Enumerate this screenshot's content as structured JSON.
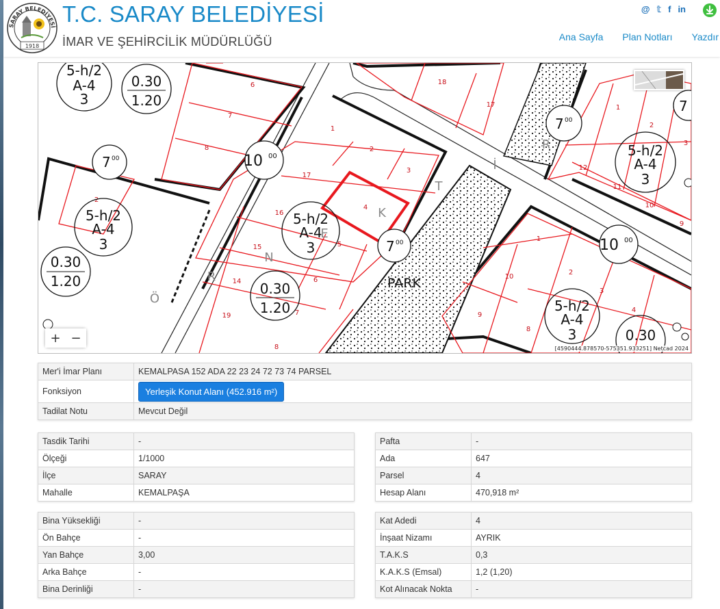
{
  "header": {
    "title": "T.C. SARAY BELEDİYESİ",
    "subtitle": "İMAR VE ŞEHİRCİLİK MÜDÜRLÜĞÜ",
    "logo": {
      "ring_text": "SARAY BELEDİYESİ",
      "year": "1918"
    },
    "socials": {
      "email": "@",
      "twitter": "𝕥",
      "facebook": "f",
      "linkedin": "in"
    },
    "nav": [
      "Ana Sayfa",
      "Plan Notları",
      "Yazdır"
    ]
  },
  "map": {
    "park_label": "PARK",
    "street_letters": [
      "Ö",
      "R",
      "N",
      "E",
      "K",
      "T",
      "İ",
      "R"
    ],
    "parcels_top_left": [
      "6",
      "7",
      "8",
      "2"
    ],
    "parcels_center": [
      "1",
      "2",
      "3",
      "17",
      "16",
      "15",
      "14",
      "19",
      "4",
      "5",
      "6",
      "7",
      "8"
    ],
    "parcels_right": [
      "18",
      "17",
      "1",
      "2",
      "3",
      "12",
      "11",
      "10",
      "9",
      "1",
      "2",
      "3",
      "4",
      "10",
      "9",
      "8"
    ],
    "zones": [
      {
        "top": "5-h/2",
        "mid": "A-4",
        "bot": "3"
      },
      {
        "top": "5-h/2",
        "mid": "A-4",
        "bot": "3"
      },
      {
        "top": "5-h/2",
        "mid": "A-4",
        "bot": "3"
      },
      {
        "top": "5-h/2",
        "mid": "A-4",
        "bot": "3"
      },
      {
        "top": "5-h/2",
        "mid": "A-4",
        "bot": "3"
      }
    ],
    "ratios": [
      {
        "top": "0.30",
        "bot": "1.20"
      },
      {
        "top": "0.30",
        "bot": "1.20"
      },
      {
        "top": "0.30",
        "bot": "1.20"
      },
      {
        "top": "0.30",
        "bot": ""
      }
    ],
    "road_widths": {
      "main": "10",
      "sub": "00",
      "small": "7",
      "small_sub": "00"
    },
    "zoom_in": "+",
    "zoom_out": "−",
    "coords": "[4590444.878570-575351.933251] Netcad 2024"
  },
  "plan_table": {
    "rows": [
      {
        "label": "Mer'i İmar Planı",
        "value": "KEMALPASA 152 ADA 22 23 24 72 73 74 PARSEL"
      },
      {
        "label": "Fonksiyon",
        "value": "Yerleşik Konut Alanı (452.916 m²)"
      },
      {
        "label": "Tadilat Notu",
        "value": "Mevcut Değil"
      }
    ]
  },
  "info_left": {
    "rows": [
      {
        "label": "Tasdik Tarihi",
        "value": "-"
      },
      {
        "label": "Ölçeği",
        "value": "1/1000"
      },
      {
        "label": "İlçe",
        "value": "SARAY"
      },
      {
        "label": "Mahalle",
        "value": "KEMALPAŞA"
      }
    ]
  },
  "info_right": {
    "rows": [
      {
        "label": "Pafta",
        "value": "-"
      },
      {
        "label": "Ada",
        "value": "647"
      },
      {
        "label": "Parsel",
        "value": "4"
      },
      {
        "label": "Hesap Alanı",
        "value": "470,918 m²"
      }
    ]
  },
  "build_left": {
    "rows": [
      {
        "label": "Bina Yüksekliği",
        "value": "-"
      },
      {
        "label": "Ön Bahçe",
        "value": "-"
      },
      {
        "label": "Yan Bahçe",
        "value": "3,00"
      },
      {
        "label": "Arka Bahçe",
        "value": "-"
      },
      {
        "label": "Bina Derinliği",
        "value": "-"
      }
    ]
  },
  "build_right": {
    "rows": [
      {
        "label": "Kat Adedi",
        "value": "4"
      },
      {
        "label": "İnşaat Nizamı",
        "value": "AYRIK"
      },
      {
        "label": "T.A.K.S",
        "value": "0,3"
      },
      {
        "label": "K.A.K.S (Emsal)",
        "value": "1,2 (1,20)"
      },
      {
        "label": "Kot Alınacak Nokta",
        "value": "-"
      }
    ]
  }
}
